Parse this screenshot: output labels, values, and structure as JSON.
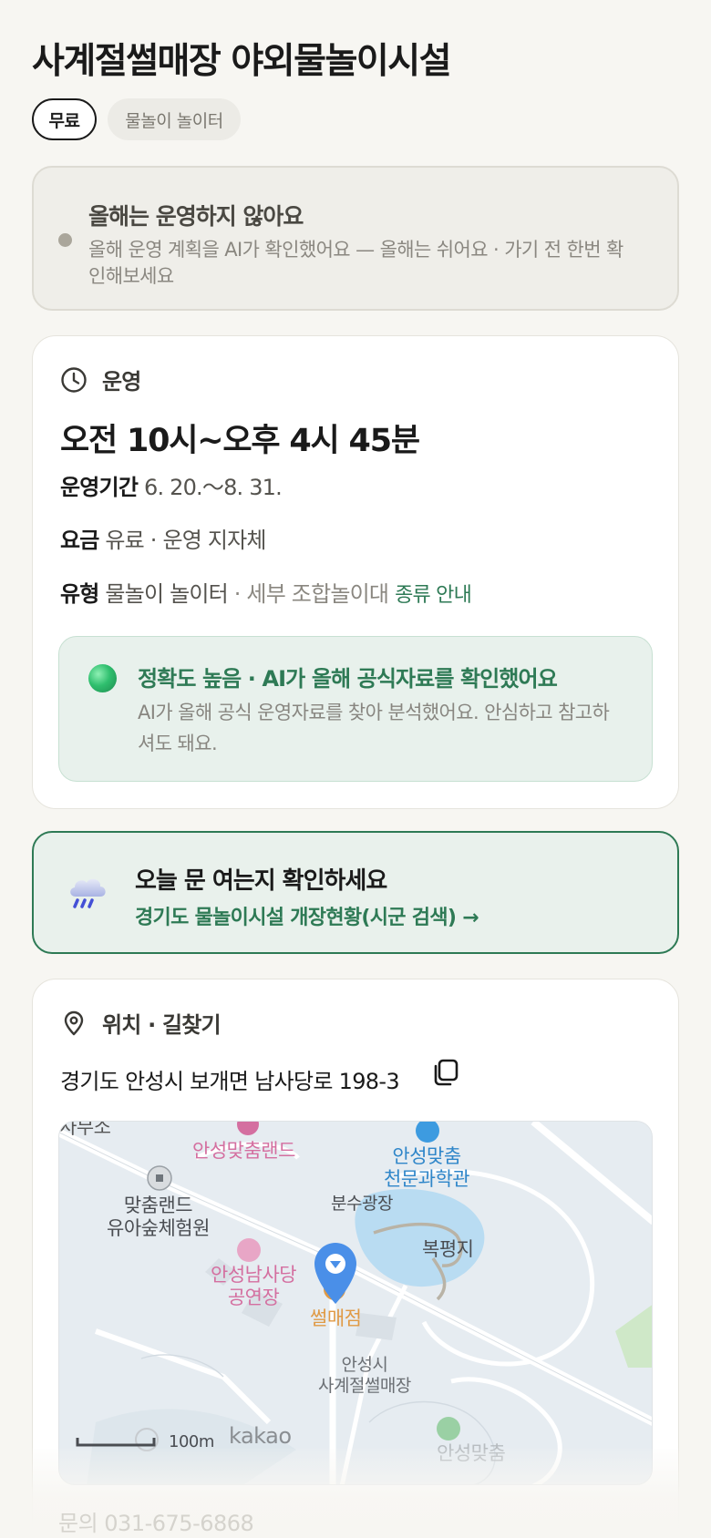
{
  "header": {
    "title": "사계절썰매장 야외물놀이시설",
    "chips": [
      "무료",
      "물놀이 놀이터"
    ]
  },
  "notice": {
    "title": "올해는 운영하지 않아요",
    "body": "올해 운영 계획을 AI가 확인했어요 — 올해는 쉬어요 · 가기 전 한번 확인해보세요"
  },
  "operation": {
    "label": "운영",
    "hours": "오전 10시~오후 4시 45분",
    "period_label": "운영기간",
    "period_value": "6. 20.～8. 31.",
    "fee_label": "요금",
    "fee_value": "유료 · 운영 지자체",
    "type_label": "유형",
    "type_value": "물놀이 놀이터",
    "type_detail": "· 세부 조합놀이대",
    "type_link": "종류 안내",
    "accuracy_title": "정확도 높음 · AI가 올해 공식자료를 확인했어요",
    "accuracy_body": "AI가 올해 공식 운영자료를 찾아 분석했어요. 안심하고 참고하셔도 돼요."
  },
  "today": {
    "title": "오늘 문 여는지 확인하세요",
    "link": "경기도 물놀이시설 개장현황(시군 검색) →"
  },
  "location": {
    "label": "위치 · 길찾기",
    "address": "경기도 안성시 보개면 남사당로 198-3",
    "map_labels": {
      "top_left": "사무소",
      "dance_land": "안성맞춤랜드",
      "observatory_1": "안성맞춤",
      "observatory_2": "천문과학관",
      "kids_forest_1": "맞춤랜드",
      "kids_forest_2": "유아숲체험원",
      "fountain": "분수광장",
      "pond": "복평지",
      "theater_1": "안성남사당",
      "theater_2": "공연장",
      "sled_shop": "썰매점",
      "sled_park_1": "안성시",
      "sled_park_2": "사계절썰매장",
      "bottom_place": "안성맞춤",
      "scale": "100m",
      "provider": "kakao"
    }
  },
  "contact": "문의 031-675-6868",
  "colors": {
    "accent_green": "#2e7a55",
    "map_pin": "#4a8fe8",
    "poi_pink": "#d46fa0",
    "poi_orange": "#e09a45"
  }
}
